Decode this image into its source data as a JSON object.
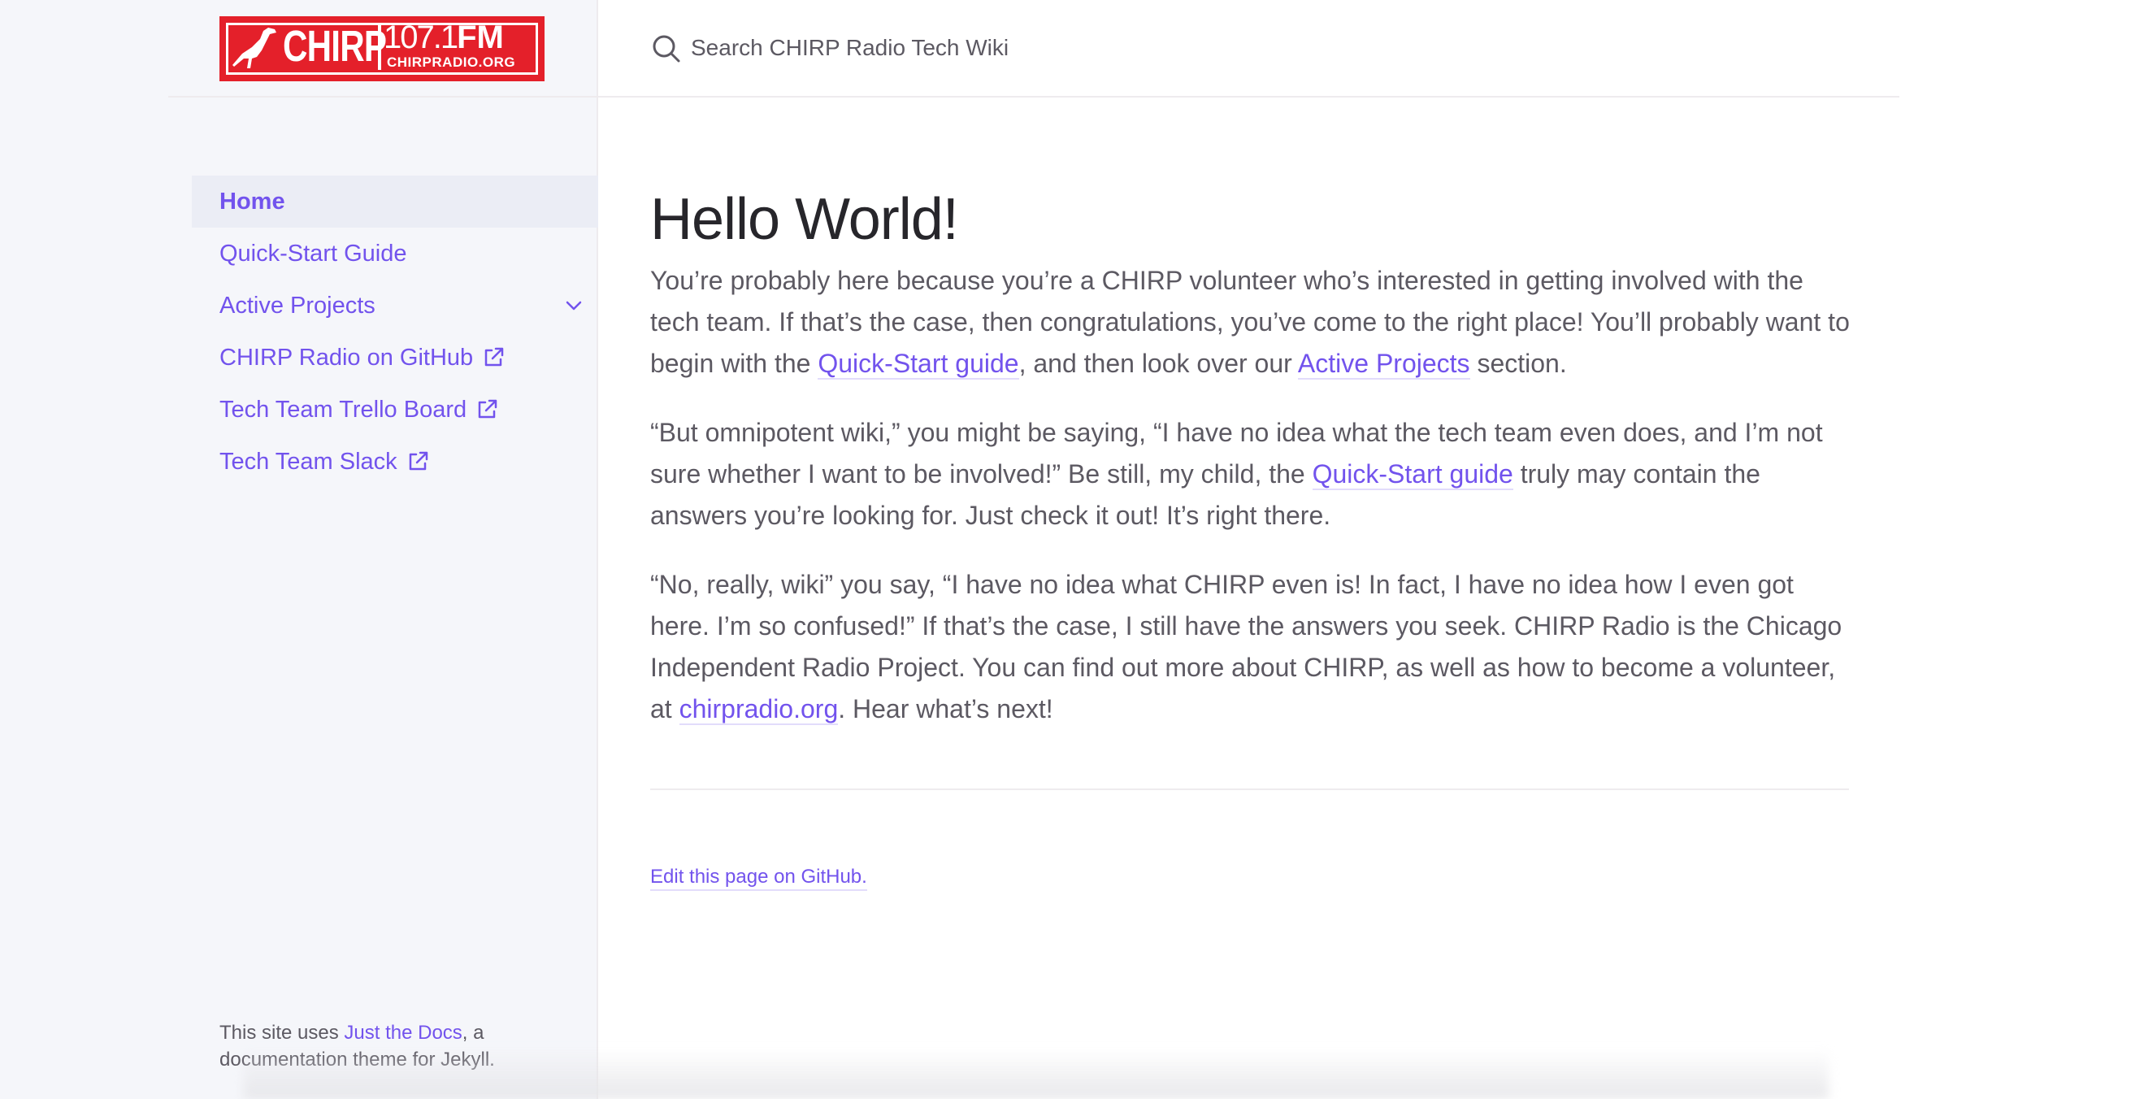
{
  "logo": {
    "word": "CHIRP",
    "freq_number": "107.1",
    "freq_unit": "FM",
    "url": "CHIRPRADIO.ORG",
    "brand_color": "#e4202a"
  },
  "search": {
    "placeholder": "Search CHIRP Radio Tech Wiki",
    "icon": "search-icon"
  },
  "nav": {
    "items": [
      {
        "label": "Home",
        "active": true
      },
      {
        "label": "Quick-Start Guide"
      },
      {
        "label": "Active Projects",
        "expandable": true
      },
      {
        "label": "CHIRP Radio on GitHub",
        "external": true
      },
      {
        "label": "Tech Team Trello Board",
        "external": true
      },
      {
        "label": "Tech Team Slack",
        "external": true
      }
    ]
  },
  "main": {
    "title": "Hello World!",
    "p1": {
      "a": "You’re probably here because you’re a CHIRP volunteer who’s interested in getting involved with the tech team. If that’s the case, then congratulations, you’ve come to the right place! You’ll probably want to begin with the ",
      "link1": "Quick-Start guide",
      "b": ", and then look over our ",
      "link2": "Active Projects",
      "c": " section."
    },
    "p2": {
      "a": "“But omnipotent wiki,” you might be saying, “I have no idea what the tech team even does, and I’m not sure whether I want to be involved!” Be still, my child, the ",
      "link1": "Quick-Start guide",
      "b": " truly may contain the answers you’re looking for. Just check it out! It’s right there."
    },
    "p3": {
      "a": "“No, really, wiki” you say, “I have no idea what CHIRP even is! In fact, I have no idea how I even got here. I’m so confused!” If that’s the case, I still have the answers you seek. CHIRP Radio is the Chicago Independent Radio Project. You can find out more about CHIRP, as well as how to become a volunteer, at ",
      "link1": "chirpradio.org",
      "b": ". Hear what’s next!"
    },
    "edit_link": "Edit this page on GitHub."
  },
  "footer": {
    "a": "This site uses ",
    "link": "Just the Docs",
    "b": ", a documentation theme for Jekyll."
  },
  "colors": {
    "accent": "#7253ed",
    "sidebar_bg": "#f5f6fa",
    "text": "#5c5962"
  }
}
